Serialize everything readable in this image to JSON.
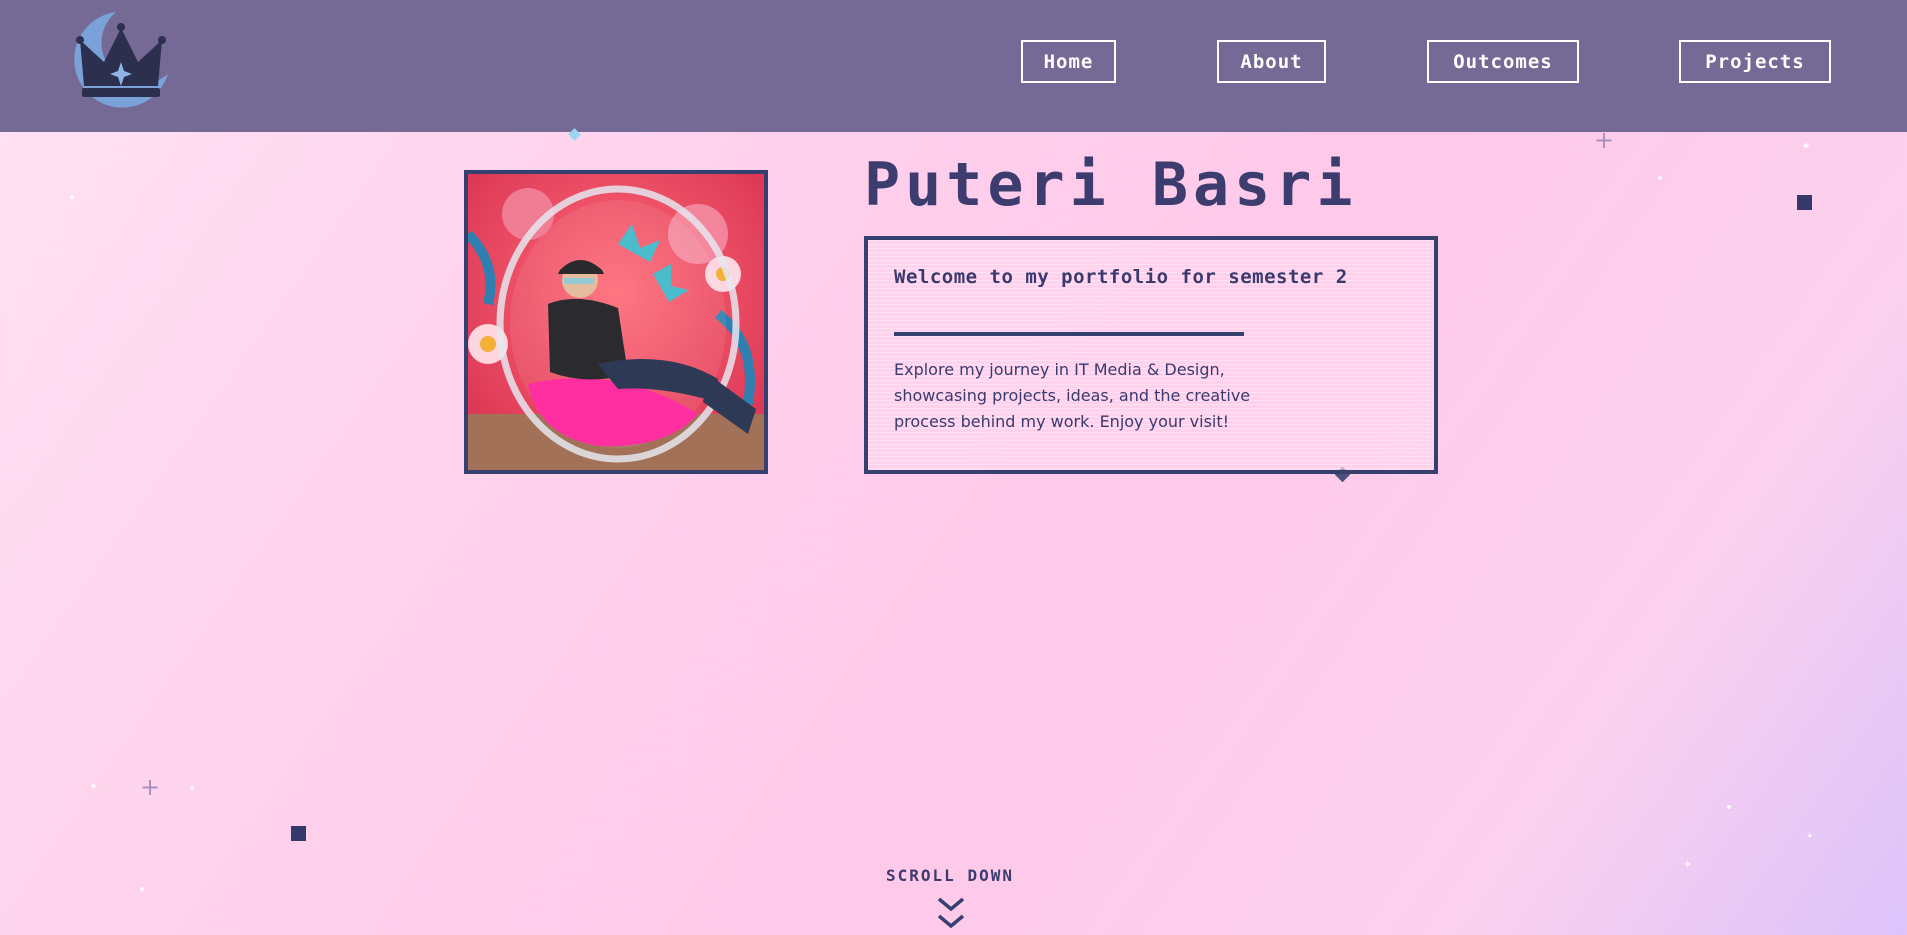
{
  "header": {
    "logo_icon": "crescent-moon-crown-icon",
    "nav": [
      {
        "label": "Home"
      },
      {
        "label": "About"
      },
      {
        "label": "Outcomes"
      },
      {
        "label": "Projects"
      }
    ]
  },
  "hero": {
    "name": "Puteri Basri",
    "photo_alt": "Puteri Basri",
    "welcome_heading": "Welcome to my portfolio for semester 2",
    "welcome_text": "Explore my journey in IT Media & Design, showcasing projects, ideas, and the creative process behind my work. Enjoy your visit!"
  },
  "scroll": {
    "label": "SCROLL DOWN",
    "icon": "double-chevron-down-icon"
  },
  "colors": {
    "header_bg": "#756995",
    "accent_navy": "#35406f",
    "text": "#3d3c6f",
    "bg_pink": "#ffd0ec",
    "bg_lavender": "#dcc3fb"
  }
}
